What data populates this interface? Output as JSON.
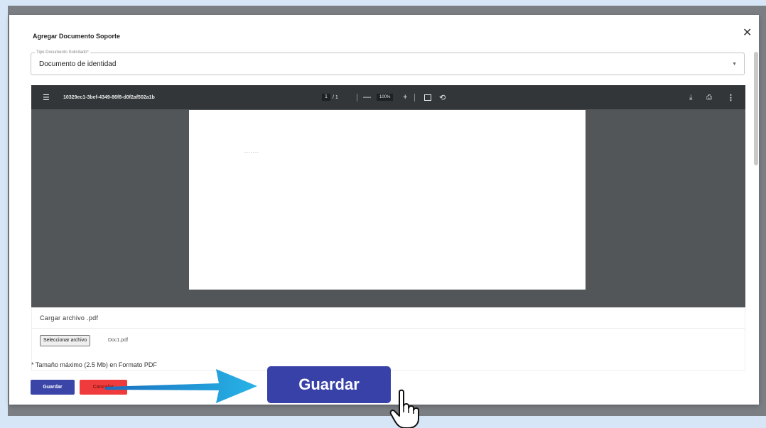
{
  "dialog": {
    "title": "Agregar Documento Soporte",
    "close_glyph": "✕"
  },
  "document_type": {
    "legend": "Tipo Documento Solicitado*",
    "value": "Documento de identidad",
    "caret": "▼"
  },
  "pdf_viewer": {
    "menu_glyph": "☰",
    "filename": "10329ec1-3bef-4349-86f8-d0f2af502a1b",
    "page_current": "1",
    "page_total": "/ 1",
    "zoom_out": "—",
    "zoom": "100%",
    "zoom_in": "+",
    "rotate_glyph": "⟲",
    "download_glyph": "⤓",
    "print_glyph": "⎙",
    "more_glyph": "⋮",
    "page_text": "·······"
  },
  "upload": {
    "title": "Cargar archivo .pdf",
    "button_label": "Seleccionar archivo",
    "file_name": "Doc1.pdf",
    "note": "* Tamaño máximo (2.5 Mb) en Formato PDF"
  },
  "actions": {
    "save_label": "Guardar",
    "cancel_label": "Cancelar"
  },
  "callout": {
    "save_label": "Guardar"
  },
  "colors": {
    "primary": "#3841a8",
    "danger": "#ef3b3b",
    "arrow": "#1a9ad6",
    "toolbar": "#323639"
  }
}
